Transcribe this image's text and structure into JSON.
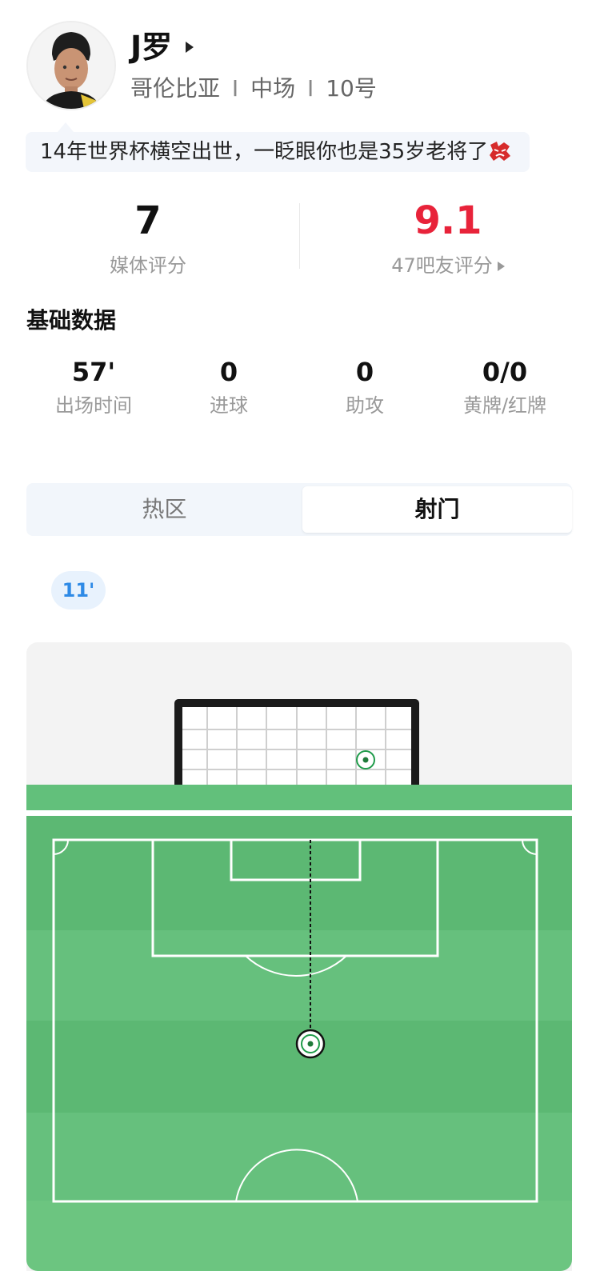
{
  "player": {
    "name": "J罗",
    "country": "哥伦比亚",
    "position": "中场",
    "number": "10号",
    "separator": "I",
    "comment": "14年世界杯横空出世，一眨眼你也是35岁老将了",
    "comment_emoji": "sad-face-icon"
  },
  "ratings": {
    "media": {
      "value": "7",
      "label": "媒体评分"
    },
    "fans": {
      "value": "9.1",
      "label": "47吧友评分",
      "color": "#e8233a"
    }
  },
  "basic_stats": {
    "title": "基础数据",
    "items": [
      {
        "value": "57'",
        "label": "出场时间"
      },
      {
        "value": "0",
        "label": "进球"
      },
      {
        "value": "0",
        "label": "助攻"
      },
      {
        "value": "0/0",
        "label": "黄牌/红牌"
      }
    ]
  },
  "tabs": {
    "items": [
      {
        "label": "热区",
        "active": false
      },
      {
        "label": "射门",
        "active": true
      }
    ]
  },
  "shots": {
    "selected_minute": "11'",
    "accent": "#2e8ae6"
  },
  "colors": {
    "pitch_green": "#62c07b",
    "fan_rating": "#e8233a",
    "shot_marker": "#1f9b4a"
  }
}
